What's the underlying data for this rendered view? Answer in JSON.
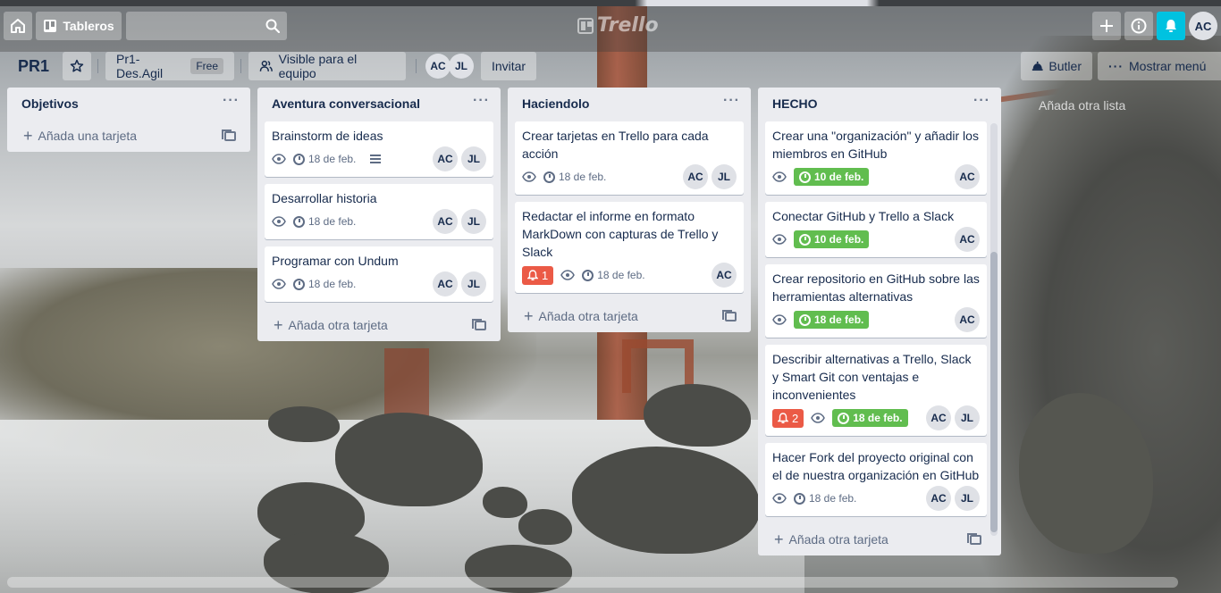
{
  "header": {
    "boards_label": "Tableros",
    "logo_text": "Trello",
    "user_initials": "AC"
  },
  "board": {
    "title": "PR1",
    "team_name": "Pr1-Des.Agil",
    "team_plan": "Free",
    "visibility_label": "Visible para el equipo",
    "members": [
      "AC",
      "JL"
    ],
    "invite_label": "Invitar",
    "butler_label": "Butler",
    "menu_label": "Mostrar menú",
    "add_list_label": "Añada otra lista"
  },
  "lists": [
    {
      "title": "Objetivos",
      "add_card_label": "Añada una tarjeta",
      "cards": []
    },
    {
      "title": "Aventura conversacional",
      "add_card_label": "Añada otra tarjeta",
      "cards": [
        {
          "title": "Brainstorm de ideas",
          "due": "18 de feb.",
          "members": [
            "AC",
            "JL"
          ]
        },
        {
          "title": "Desarrollar historia",
          "due": "18 de feb.",
          "members": [
            "AC",
            "JL"
          ]
        },
        {
          "title": "Programar con Undum",
          "due": "18 de feb.",
          "members": [
            "AC",
            "JL"
          ]
        }
      ]
    },
    {
      "title": "Haciendolo",
      "add_card_label": "Añada otra tarjeta",
      "cards": [
        {
          "title": "Crear tarjetas en Trello para cada acción",
          "due": "18 de feb.",
          "members": [
            "AC",
            "JL"
          ]
        },
        {
          "title": "Redactar el informe en formato MarkDown con capturas de Trello y Slack",
          "notifications": "1",
          "due": "18 de feb.",
          "members": [
            "AC"
          ]
        }
      ]
    },
    {
      "title": "HECHO",
      "add_card_label": "Añada otra tarjeta",
      "cards": [
        {
          "title": "Crear una \"organización\" y añadir los miembros en GitHub",
          "due": "10 de feb.",
          "members": [
            "AC"
          ]
        },
        {
          "title": "Conectar GitHub y Trello a Slack",
          "due": "10 de feb.",
          "members": [
            "AC"
          ]
        },
        {
          "title": "Crear repositorio en GitHub sobre las herramientas alternativas",
          "due": "18 de feb.",
          "members": [
            "AC"
          ]
        },
        {
          "title": "Describir alternativas a Trello, Slack y Smart Git con ventajas e inconvenientes",
          "notifications": "2",
          "due": "18 de feb.",
          "members": [
            "AC",
            "JL"
          ]
        },
        {
          "title": "Hacer Fork del proyecto original con el de nuestra organización en GitHub",
          "due": "18 de feb.",
          "members": [
            "AC",
            "JL"
          ]
        }
      ]
    }
  ],
  "colors": {
    "list_bg": "#ebecf0",
    "due_complete": "#61bd4f",
    "notification": "#eb5a46",
    "bell_active": "#00c2e0"
  }
}
